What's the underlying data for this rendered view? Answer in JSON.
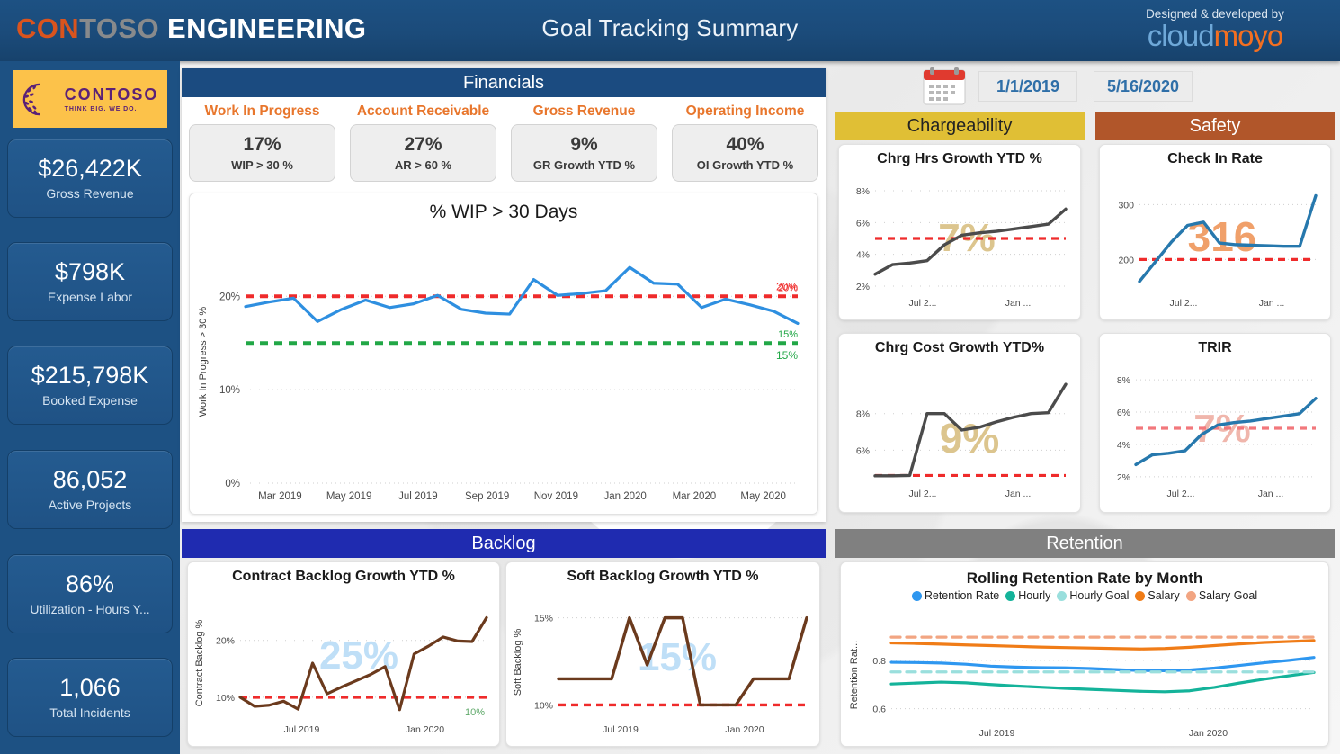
{
  "header": {
    "brand_part1": "CON",
    "brand_part2": "TOSO",
    "brand_part3": "ENGINEERING",
    "title": "Goal Tracking Summary",
    "credit_line": "Designed & developed by",
    "credit_brand1": "cloud",
    "credit_brand2": "moyo",
    "colors": {
      "bar": "#1d5183",
      "orange": "#d9541e",
      "gray": "#888a8c",
      "cloud_blue": "#6ea8d8",
      "moyo_orange": "#f36f21"
    }
  },
  "sidebar": {
    "logo": {
      "name": "CONTOSO",
      "tagline": "THINK BIG. WE DO.",
      "bg": "#fcc24a",
      "fg": "#5b2177"
    },
    "kpis": [
      {
        "value": "$26,422K",
        "label": "Gross Revenue"
      },
      {
        "value": "$798K",
        "label": "Expense Labor"
      },
      {
        "value": "$215,798K",
        "label": "Booked Expense"
      },
      {
        "value": "86,052",
        "label": "Active Projects"
      },
      {
        "value": "86%",
        "label": "Utilization - Hours Y..."
      },
      {
        "value": "1,066",
        "label": "Total Incidents"
      }
    ]
  },
  "slicers": {
    "calendar_icon": "calendar-icon",
    "start_date": "1/1/2019",
    "end_date": "5/16/2020"
  },
  "financials": {
    "panel_title": "Financials",
    "header_color": "#1b4b80",
    "metrics": [
      {
        "head": "Work In Progress",
        "value": "17%",
        "sub": "WIP > 30 %"
      },
      {
        "head": "Account Receivable",
        "value": "27%",
        "sub": "AR > 60 %"
      },
      {
        "head": "Gross Revenue",
        "value": "9%",
        "sub": "GR Growth YTD %"
      },
      {
        "head": "Operating Income",
        "value": "40%",
        "sub": "OI Growth YTD %"
      }
    ]
  },
  "chargeability": {
    "panel_title": "Chargeability",
    "header_color": "#e0bf35"
  },
  "safety": {
    "panel_title": "Safety",
    "header_color": "#b1562a"
  },
  "backlog": {
    "panel_title": "Backlog",
    "header_color": "#1f2bb0"
  },
  "retention": {
    "panel_title": "Retention",
    "header_color": "#808080"
  },
  "chart_data": [
    {
      "id": "wip",
      "type": "line",
      "title": "% WIP > 30 Days",
      "ylabel": "Work In Progress > 30 %",
      "xlabel": "",
      "ylim": [
        0,
        26
      ],
      "yticks": [
        "0%",
        "10%",
        "20%"
      ],
      "ytick_values": [
        0,
        10,
        20
      ],
      "xticks": [
        "Mar 2019",
        "May 2019",
        "Jul 2019",
        "Sep 2019",
        "Nov 2019",
        "Jan 2020",
        "Mar 2020",
        "May 2020"
      ],
      "grid": true,
      "series": [
        {
          "name": "WIP > 30 Days",
          "color": "#2e8fe0",
          "values": [
            18.9,
            19.4,
            19.8,
            17.3,
            18.6,
            19.6,
            18.8,
            19.2,
            20.1,
            18.6,
            18.2,
            18.1,
            21.8,
            20.1,
            20.3,
            20.6,
            23.1,
            21.4,
            21.3,
            18.8,
            19.7,
            19.1,
            18.4,
            17.1
          ]
        }
      ],
      "goal_lines": [
        {
          "label": "20%",
          "value": 20,
          "color": "#ef2b2b",
          "style": "dashed"
        },
        {
          "label": "15%",
          "value": 15,
          "color": "#21a746",
          "style": "dashed"
        }
      ]
    },
    {
      "id": "chrg-hrs",
      "type": "line",
      "title": "Chrg Hrs Growth YTD %",
      "watermark": "7%",
      "watermark_color": "#dcc58e",
      "ylim": [
        1.6,
        8.4
      ],
      "yticks": [
        "2%",
        "4%",
        "6%",
        "8%"
      ],
      "ytick_values": [
        2,
        4,
        6,
        8
      ],
      "xticks": [
        "Jul 2...",
        "Jan ..."
      ],
      "series": [
        {
          "name": "Chrg Hrs Growth YTD %",
          "color": "#4b4b4b",
          "values": [
            2.75,
            3.35,
            3.45,
            3.6,
            4.6,
            5.2,
            5.35,
            5.45,
            5.6,
            5.75,
            5.9,
            6.85
          ]
        }
      ],
      "goal_lines": [
        {
          "label": "",
          "value": 5.0,
          "color": "#ef2b2b",
          "style": "dashed"
        }
      ]
    },
    {
      "id": "chrg-cost",
      "type": "line",
      "title": "Chrg Cost Growth YTD%",
      "watermark": "9%",
      "watermark_color": "#dcc58e",
      "ylim": [
        4.2,
        10.0
      ],
      "yticks": [
        "6%",
        "8%"
      ],
      "ytick_values": [
        6,
        8
      ],
      "xticks": [
        "Jul 2...",
        "Jan ..."
      ],
      "series": [
        {
          "name": "Chrg Cost Growth YTD%",
          "color": "#4b4b4b",
          "values": [
            4.6,
            4.6,
            4.62,
            8.0,
            8.0,
            7.1,
            7.25,
            7.55,
            7.8,
            8.0,
            8.05,
            9.6
          ]
        }
      ],
      "goal_lines": [
        {
          "label": "",
          "value": 4.62,
          "color": "#ef2b2b",
          "style": "dashed"
        }
      ]
    },
    {
      "id": "check-in-rate",
      "type": "line",
      "title": "Check In Rate",
      "watermark": "316",
      "watermark_color": "#f0a06a",
      "ylim": [
        140,
        330
      ],
      "yticks": [
        "200",
        "300"
      ],
      "ytick_values": [
        200,
        300
      ],
      "xticks": [
        "Jul 2...",
        "Jan ..."
      ],
      "series": [
        {
          "name": "Check In Rate",
          "color": "#2678ad",
          "values": [
            160,
            196,
            232,
            262,
            268,
            230,
            227,
            226,
            225,
            224,
            224,
            316
          ]
        }
      ],
      "goal_lines": [
        {
          "label": "",
          "value": 200,
          "color": "#ef2b2b",
          "style": "dashed"
        }
      ]
    },
    {
      "id": "trir",
      "type": "line",
      "title": "TRIR",
      "watermark": "7%",
      "watermark_color": "#f0b6ac",
      "ylim": [
        1.6,
        8.4
      ],
      "yticks": [
        "2%",
        "4%",
        "6%",
        "8%"
      ],
      "ytick_values": [
        2,
        4,
        6,
        8
      ],
      "xticks": [
        "Jul 2...",
        "Jan ..."
      ],
      "series": [
        {
          "name": "TRIR",
          "color": "#2678ad",
          "values": [
            2.75,
            3.35,
            3.45,
            3.6,
            4.6,
            5.2,
            5.35,
            5.45,
            5.6,
            5.75,
            5.9,
            6.85
          ]
        }
      ],
      "goal_lines": [
        {
          "label": "",
          "value": 5.0,
          "color": "#f2787c",
          "style": "dashed"
        }
      ]
    },
    {
      "id": "contract-backlog",
      "type": "line",
      "title": "Contract Backlog Growth YTD %",
      "ylabel": "Contract Backlog %",
      "watermark": "25%",
      "watermark_color": "#bfdff7",
      "ylim": [
        6.5,
        25.5
      ],
      "yticks": [
        "10%",
        "20%"
      ],
      "ytick_values": [
        10,
        20
      ],
      "xticks": [
        "Jul 2019",
        "Jan 2020"
      ],
      "series": [
        {
          "name": "Contract Backlog Growth YTD %",
          "color": "#6b3a1d",
          "values": [
            10.0,
            8.4,
            8.6,
            9.3,
            7.9,
            16.0,
            10.6,
            11.8,
            12.9,
            14.0,
            15.4,
            7.8,
            17.6,
            19.0,
            20.6,
            19.9,
            19.8,
            24.0
          ]
        }
      ],
      "goal_lines": [
        {
          "label": "10%",
          "value": 10,
          "color": "#ef2b2b",
          "style": "dashed",
          "label_color": "#5fa96a"
        }
      ]
    },
    {
      "id": "soft-backlog",
      "type": "line",
      "title": "Soft Backlog Growth YTD %",
      "ylabel": "Soft Backlog %",
      "watermark": "15%",
      "watermark_color": "#bfdff7",
      "ylim": [
        9.3,
        15.6
      ],
      "yticks": [
        "10%",
        "15%"
      ],
      "ytick_values": [
        10,
        15
      ],
      "xticks": [
        "Jul 2019",
        "Jan 2020"
      ],
      "series": [
        {
          "name": "Soft Backlog Growth YTD %",
          "color": "#6b3a1d",
          "values": [
            11.5,
            11.5,
            11.5,
            11.5,
            15.0,
            12.3,
            15.0,
            15.0,
            10.0,
            10.0,
            10.0,
            11.5,
            11.5,
            11.5,
            15.0
          ]
        }
      ],
      "goal_lines": [
        {
          "label": "",
          "value": 10,
          "color": "#ef2b2b",
          "style": "dashed"
        }
      ]
    },
    {
      "id": "rolling-retention",
      "type": "line",
      "title": "Rolling Retention Rate by Month",
      "ylabel": "Retention Rat...",
      "ylim": [
        0.55,
        0.93
      ],
      "yticks": [
        "0.6",
        "0.8"
      ],
      "ytick_values": [
        0.6,
        0.8
      ],
      "xticks": [
        "Jul 2019",
        "Jan 2020"
      ],
      "legend_position": "top",
      "series": [
        {
          "name": "Retention Rate",
          "color": "#2e97f0",
          "style": "solid",
          "values": [
            0.792,
            0.791,
            0.789,
            0.784,
            0.776,
            0.772,
            0.77,
            0.769,
            0.766,
            0.762,
            0.758,
            0.757,
            0.76,
            0.768,
            0.779,
            0.79,
            0.8,
            0.812
          ]
        },
        {
          "name": "Hourly",
          "color": "#14b39a",
          "style": "solid",
          "values": [
            0.702,
            0.706,
            0.71,
            0.707,
            0.7,
            0.694,
            0.689,
            0.684,
            0.68,
            0.676,
            0.672,
            0.67,
            0.674,
            0.688,
            0.706,
            0.722,
            0.736,
            0.75
          ]
        },
        {
          "name": "Hourly Goal",
          "color": "#9adfdd",
          "style": "dashed",
          "values": [
            0.752,
            0.752,
            0.752,
            0.752,
            0.752,
            0.752,
            0.752,
            0.752,
            0.752,
            0.752,
            0.752,
            0.752,
            0.752,
            0.752,
            0.752,
            0.752,
            0.752,
            0.752
          ]
        },
        {
          "name": "Salary",
          "color": "#f07c17",
          "style": "solid",
          "values": [
            0.872,
            0.87,
            0.867,
            0.864,
            0.861,
            0.858,
            0.855,
            0.853,
            0.851,
            0.849,
            0.847,
            0.849,
            0.854,
            0.861,
            0.868,
            0.874,
            0.878,
            0.882
          ]
        },
        {
          "name": "Salary Goal",
          "color": "#f2a582",
          "style": "dashed",
          "values": [
            0.896,
            0.896,
            0.896,
            0.896,
            0.896,
            0.896,
            0.896,
            0.896,
            0.896,
            0.896,
            0.896,
            0.896,
            0.896,
            0.896,
            0.896,
            0.896,
            0.896,
            0.896
          ]
        }
      ]
    }
  ]
}
